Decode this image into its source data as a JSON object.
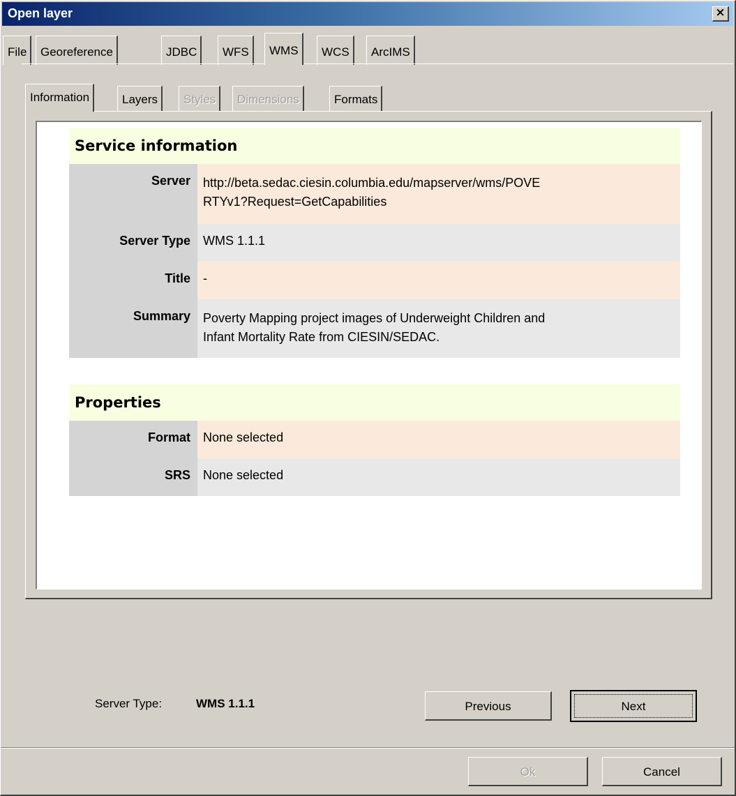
{
  "window": {
    "title": "Open layer",
    "close_label": "×"
  },
  "top_tabs": [
    "File",
    "Georeference",
    "JDBC",
    "WFS",
    "WMS",
    "WCS",
    "ArcIMS"
  ],
  "inner_tabs": [
    "Information",
    "Layers",
    "Styles",
    "Dimensions",
    "Formats"
  ],
  "service": {
    "heading": "Service information",
    "rows": [
      {
        "label": "Server",
        "value": "http://beta.sedac.ciesin.columbia.edu/mapserver/wms/POVERTYv1?Request=GetCapabilities",
        "value_line1": "http://beta.sedac.ciesin.columbia.edu/mapserver/wms/POVE",
        "value_line2": "RTYv1?Request=GetCapabilities"
      },
      {
        "label": "Server Type",
        "value": "WMS 1.1.1"
      },
      {
        "label": "Title",
        "value": "-"
      },
      {
        "label": "Summary",
        "value_line1": "Poverty Mapping project images of Underweight Children and",
        "value_line2": "Infant Mortality Rate from CIESIN/SEDAC."
      }
    ]
  },
  "properties": {
    "heading": "Properties",
    "rows": [
      {
        "label": "Format",
        "value": "None selected"
      },
      {
        "label": "SRS",
        "value": "None selected"
      }
    ]
  },
  "status": {
    "label": "Server Type:",
    "value": "WMS 1.1.1"
  },
  "buttons": {
    "previous": "Previous",
    "next": "Next",
    "ok": "Ok",
    "cancel": "Cancel"
  },
  "colors": {
    "title_start": "#0a246a",
    "section_bg": "#f8ffe0",
    "row_peach": "#fbeadb",
    "row_grey": "#e8e8e8",
    "label_bg": "#d4d4d4"
  }
}
